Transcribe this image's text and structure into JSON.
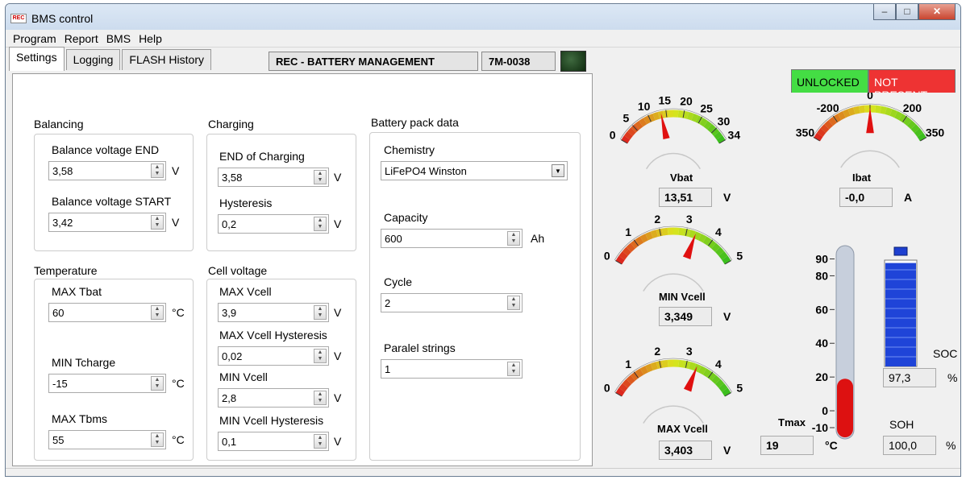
{
  "window": {
    "title": "BMS control",
    "icon_text": "REC",
    "controls": [
      "minimize-icon",
      "maximize-icon",
      "close-icon"
    ]
  },
  "menu": [
    "Program",
    "Report",
    "BMS",
    "Help"
  ],
  "tabs": [
    {
      "label": "Settings",
      "active": true
    },
    {
      "label": "Logging",
      "active": false
    },
    {
      "label": "FLASH History",
      "active": false
    }
  ],
  "header": {
    "device_name": "REC - BATTERY MANAGEMENT",
    "serial": "7M-0038"
  },
  "status": {
    "unlocked": "UNLOCKED",
    "unlocked_color": "#44dd44",
    "presence": "NOT PRESENT",
    "presence_color": "#ee3333"
  },
  "balancing": {
    "title": "Balancing",
    "end_label": "Balance voltage END",
    "end_value": "3,58",
    "end_unit": "V",
    "start_label": "Balance voltage START",
    "start_value": "3,42",
    "start_unit": "V"
  },
  "charging": {
    "title": "Charging",
    "end_label": "END of Charging",
    "end_value": "3,58",
    "end_unit": "V",
    "hyst_label": "Hysteresis",
    "hyst_value": "0,2",
    "hyst_unit": "V"
  },
  "temperature": {
    "title": "Temperature",
    "max_tbat_label": "MAX Tbat",
    "max_tbat_value": "60",
    "max_tbat_unit": "°C",
    "min_tcharge_label": "MIN Tcharge",
    "min_tcharge_value": "-15",
    "min_tcharge_unit": "°C",
    "max_tbms_label": "MAX Tbms",
    "max_tbms_value": "55",
    "max_tbms_unit": "°C"
  },
  "cell_voltage": {
    "title": "Cell voltage",
    "max_label": "MAX Vcell",
    "max_value": "3,9",
    "max_unit": "V",
    "max_hyst_label": "MAX Vcell Hysteresis",
    "max_hyst_value": "0,02",
    "max_hyst_unit": "V",
    "min_label": "MIN Vcell",
    "min_value": "2,8",
    "min_unit": "V",
    "min_hyst_label": "MIN Vcell Hysteresis",
    "min_hyst_value": "0,1",
    "min_hyst_unit": "V"
  },
  "pack": {
    "title": "Battery pack data",
    "chemistry_label": "Chemistry",
    "chemistry_value": "LiFePO4 Winston",
    "capacity_label": "Capacity",
    "capacity_value": "600",
    "capacity_unit": "Ah",
    "cycle_label": "Cycle",
    "cycle_value": "2",
    "strings_label": "Paralel strings",
    "strings_value": "1"
  },
  "gauges": {
    "vbat": {
      "label": "Vbat",
      "min": 0,
      "max": 34,
      "ticks": [
        "0",
        "5",
        "10",
        "15",
        "20",
        "25",
        "30",
        "34"
      ],
      "tick_values": [
        0,
        5,
        10,
        15,
        20,
        25,
        30,
        34
      ],
      "value": 13.51,
      "readout": "13,51",
      "unit": "V"
    },
    "ibat": {
      "label": "Ibat",
      "min": -350,
      "max": 350,
      "ticks": [
        "350",
        "-200",
        "0",
        "200",
        "350"
      ],
      "tick_values": [
        -350,
        -200,
        0,
        200,
        350
      ],
      "value": 0,
      "readout": "-0,0",
      "unit": "A"
    },
    "min_vcell": {
      "label": "MIN Vcell",
      "min": 0,
      "max": 5,
      "ticks": [
        "0",
        "1",
        "2",
        "3",
        "4",
        "5"
      ],
      "tick_values": [
        0,
        1,
        2,
        3,
        4,
        5
      ],
      "value": 3.349,
      "readout": "3,349",
      "unit": "V"
    },
    "max_vcell": {
      "label": "MAX Vcell",
      "min": 0,
      "max": 5,
      "ticks": [
        "0",
        "1",
        "2",
        "3",
        "4",
        "5"
      ],
      "tick_values": [
        0,
        1,
        2,
        3,
        4,
        5
      ],
      "value": 3.403,
      "readout": "3,403",
      "unit": "V"
    }
  },
  "thermometer": {
    "label": "Tmax",
    "ticks": [
      "90",
      "80",
      "60",
      "40",
      "20",
      "0",
      "-10"
    ],
    "tick_values": [
      90,
      80,
      60,
      40,
      20,
      0,
      -10
    ],
    "min": -10,
    "max": 95,
    "value": 19,
    "readout": "19",
    "unit": "°C"
  },
  "soc": {
    "label": "SOC",
    "value": 97.3,
    "readout": "97,3",
    "unit": "%"
  },
  "soh": {
    "label": "SOH",
    "readout": "100,0",
    "unit": "%"
  }
}
